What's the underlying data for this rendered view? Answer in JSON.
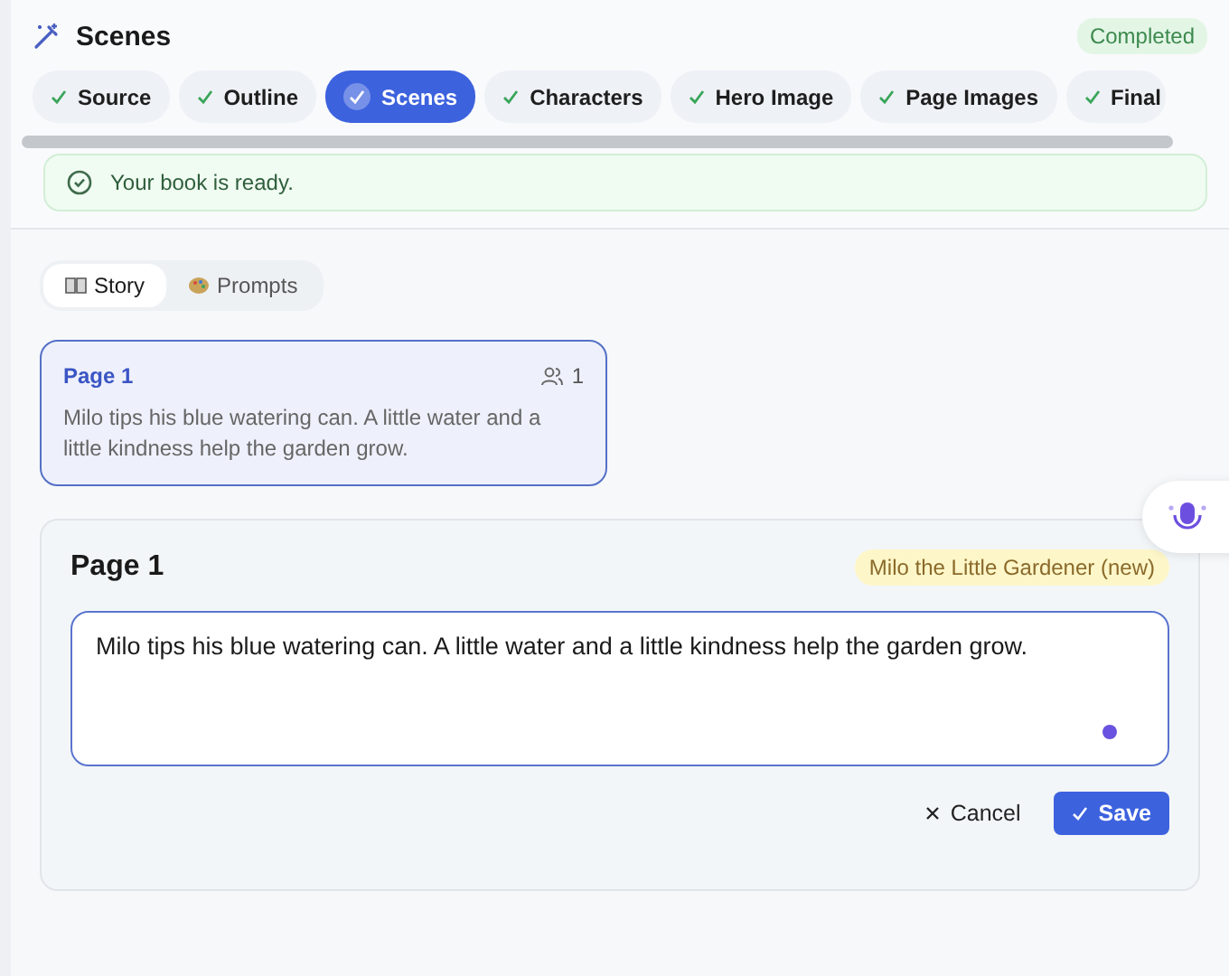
{
  "header": {
    "title": "Scenes",
    "status": "Completed"
  },
  "steps": [
    {
      "label": "Source",
      "done": true,
      "selected": false
    },
    {
      "label": "Outline",
      "done": true,
      "selected": false
    },
    {
      "label": "Scenes",
      "done": true,
      "selected": true
    },
    {
      "label": "Characters",
      "done": true,
      "selected": false
    },
    {
      "label": "Hero Image",
      "done": true,
      "selected": false
    },
    {
      "label": "Page Images",
      "done": true,
      "selected": false
    },
    {
      "label": "Final",
      "done": true,
      "selected": false
    }
  ],
  "alert": {
    "message": "Your book is ready."
  },
  "view_tabs": [
    {
      "label": "Story",
      "kind": "book",
      "selected": true
    },
    {
      "label": "Prompts",
      "kind": "palette",
      "selected": false
    }
  ],
  "pages": [
    {
      "title": "Page 1",
      "count": "1",
      "text": "Milo tips his blue watering can. A little water and a little kindness help the garden grow.",
      "selected": true
    }
  ],
  "editor": {
    "title": "Page 1",
    "tag": "Milo the Little Gardener (new)",
    "value": "Milo tips his blue watering can. A little water and a little kindness help the garden grow.",
    "cancel": "Cancel",
    "save": "Save"
  }
}
